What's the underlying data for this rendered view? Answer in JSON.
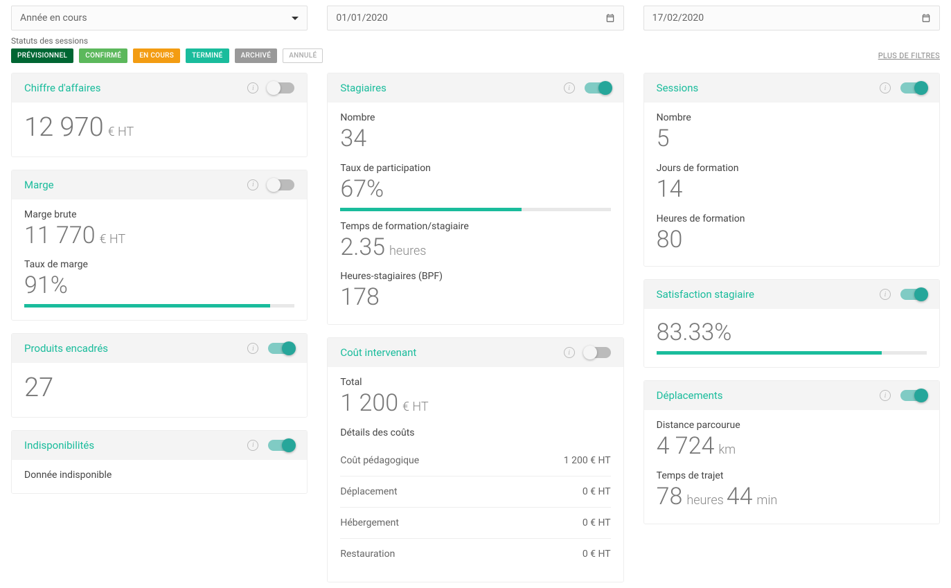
{
  "filters": {
    "period_select": "Année en cours",
    "date_from": "01/01/2020",
    "date_to": "17/02/2020",
    "status_label": "Statuts des sessions",
    "chips": {
      "previsionnel": "PRÉVISIONNEL",
      "confirme": "CONFIRMÉ",
      "encours": "EN COURS",
      "termine": "TERMINÉ",
      "archive": "ARCHIVÉ",
      "annule": "ANNULÉ"
    },
    "more_filters": "PLUS DE FILTRES"
  },
  "cards": {
    "revenue": {
      "title": "Chiffre d'affaires",
      "value": "12 970",
      "unit": "€ HT"
    },
    "margin": {
      "title": "Marge",
      "gross_label": "Marge brute",
      "gross_value": "11 770",
      "gross_unit": "€ HT",
      "rate_label": "Taux de marge",
      "rate_value": "91%",
      "rate_pct": 91
    },
    "products": {
      "title": "Produits encadrés",
      "value": "27"
    },
    "unavailability": {
      "title": "Indisponibilités",
      "message": "Donnée indisponible"
    },
    "trainees": {
      "title": "Stagiaires",
      "count_label": "Nombre",
      "count_value": "34",
      "participation_label": "Taux de participation",
      "participation_value": "67%",
      "participation_pct": 67,
      "time_label": "Temps de formation/stagiaire",
      "time_value": "2.35",
      "time_unit": "heures",
      "bpf_label": "Heures-stagiaires (BPF)",
      "bpf_value": "178"
    },
    "instructor_cost": {
      "title": "Coût intervenant",
      "total_label": "Total",
      "total_value": "1 200",
      "total_unit": "€ HT",
      "details_label": "Détails des coûts",
      "rows": [
        {
          "label": "Coût pédagogique",
          "value": "1 200 € HT"
        },
        {
          "label": "Déplacement",
          "value": "0 € HT"
        },
        {
          "label": "Hébergement",
          "value": "0 € HT"
        },
        {
          "label": "Restauration",
          "value": "0 € HT"
        }
      ]
    },
    "sessions": {
      "title": "Sessions",
      "count_label": "Nombre",
      "count_value": "5",
      "days_label": "Jours de formation",
      "days_value": "14",
      "hours_label": "Heures de formation",
      "hours_value": "80"
    },
    "satisfaction": {
      "title": "Satisfaction stagiaire",
      "value": "83.33%",
      "pct": 83.33
    },
    "travel": {
      "title": "Déplacements",
      "distance_label": "Distance parcourue",
      "distance_value": "4 724",
      "distance_unit": "km",
      "time_label": "Temps de trajet",
      "time_hours": "78",
      "time_hours_unit": "heures",
      "time_min": "44",
      "time_min_unit": "min"
    }
  }
}
